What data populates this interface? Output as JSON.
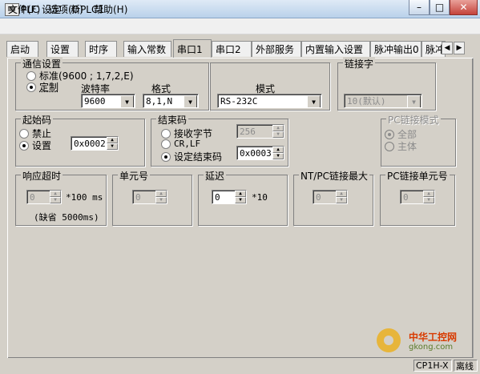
{
  "window": {
    "title": "PLC 设定 - 新PLC1",
    "minimize_glyph": "–",
    "maximize_glyph": "□",
    "close_glyph": "✕"
  },
  "menu": {
    "items": [
      {
        "label": "文件(F)"
      },
      {
        "label": "选项(O)"
      },
      {
        "label": "帮助(H)"
      }
    ]
  },
  "tabs": {
    "items": [
      {
        "label": "启动"
      },
      {
        "label": "设置"
      },
      {
        "label": "时序"
      },
      {
        "label": "输入常数"
      },
      {
        "label": "串口1"
      },
      {
        "label": "串口2"
      },
      {
        "label": "外部服务"
      },
      {
        "label": "内置输入设置"
      },
      {
        "label": "脉冲输出0"
      },
      {
        "label": "脉冲"
      }
    ],
    "active": "串口1",
    "scroll_left_glyph": "◀",
    "scroll_right_glyph": "▶"
  },
  "comm": {
    "group_label": "通信设置",
    "radio_standard": "标准(9600 ; 1,7,2,E)",
    "radio_custom": "定制",
    "selected": "定制",
    "baud_label": "波特率",
    "baud_value": "9600",
    "format_label": "格式",
    "format_value": "8,1,N",
    "mode_label": "模式",
    "mode_value": "RS-232C"
  },
  "link_word": {
    "group_label": "链接字",
    "value": "10(默认)"
  },
  "start_code": {
    "group_label": "起始码",
    "radio_disable": "禁止",
    "radio_set": "设置",
    "selected": "设置",
    "value": "0x0002"
  },
  "end_code": {
    "group_label": "结束码",
    "radio_receive_bytes": "接收字节",
    "receive_bytes_value": "256",
    "radio_crlf": "CR,LF",
    "radio_set_end": "设定结束码",
    "selected": "设定结束码",
    "end_code_value": "0x0003"
  },
  "pc_link_mode": {
    "group_label": "PC链接模式",
    "radio_all": "全部",
    "radio_master": "主体",
    "selected": "全部"
  },
  "response_timeout": {
    "group_label": "响应超时",
    "value": "0",
    "unit": "*100 ms",
    "default_note": "(缺省 5000ms)"
  },
  "unit_number": {
    "group_label": "单元号",
    "value": "0"
  },
  "delay": {
    "group_label": "延迟",
    "value": "0",
    "unit": "*10"
  },
  "nt_pc_link_max": {
    "group_label": "NT/PC链接最大",
    "value": "0"
  },
  "pc_link_unit_number": {
    "group_label": "PC链接单元号",
    "value": "0"
  },
  "watermark": {
    "title": "中华工控网",
    "url": "gkong.com"
  },
  "status": {
    "model": "CP1H-X",
    "connection": "离线"
  }
}
